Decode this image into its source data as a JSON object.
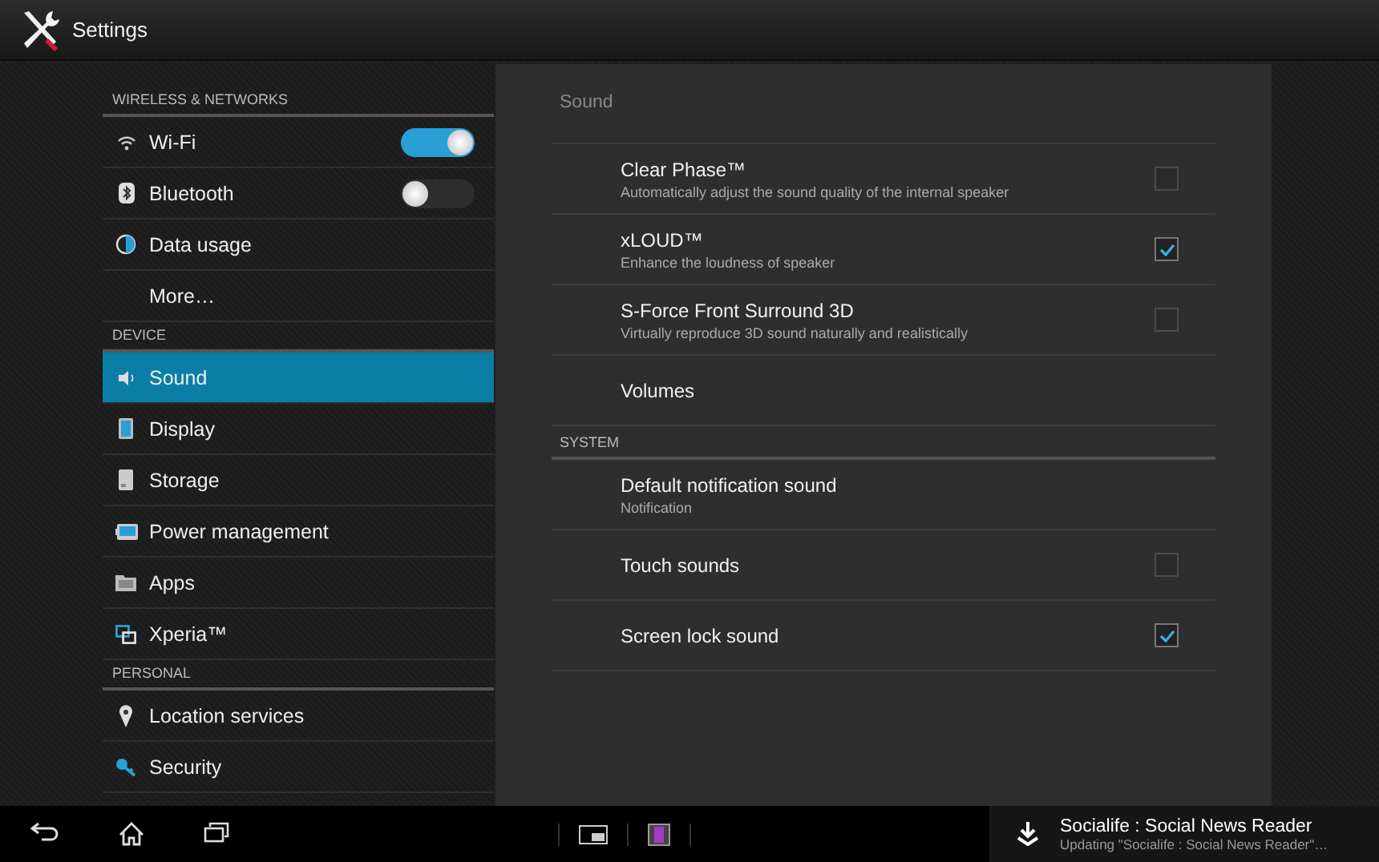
{
  "title_bar": {
    "title": "Settings"
  },
  "sidebar": {
    "sections": [
      {
        "header": "WIRELESS & NETWORKS",
        "items": [
          {
            "label": "Wi-Fi",
            "kind": "switch",
            "on": true,
            "selected": false
          },
          {
            "label": "Bluetooth",
            "kind": "switch",
            "on": false,
            "selected": false
          },
          {
            "label": "Data usage",
            "kind": "link",
            "selected": false
          },
          {
            "label": "More…",
            "kind": "link",
            "selected": false
          }
        ]
      },
      {
        "header": "DEVICE",
        "items": [
          {
            "label": "Sound",
            "kind": "link",
            "selected": true
          },
          {
            "label": "Display",
            "kind": "link",
            "selected": false
          },
          {
            "label": "Storage",
            "kind": "link",
            "selected": false
          },
          {
            "label": "Power management",
            "kind": "link",
            "selected": false
          },
          {
            "label": "Apps",
            "kind": "link",
            "selected": false
          },
          {
            "label": "Xperia™",
            "kind": "link",
            "selected": false
          }
        ]
      },
      {
        "header": "PERSONAL",
        "items": [
          {
            "label": "Location services",
            "kind": "link",
            "selected": false
          },
          {
            "label": "Security",
            "kind": "link",
            "selected": false
          }
        ]
      }
    ]
  },
  "content": {
    "title": "Sound",
    "sections": [
      {
        "items": [
          {
            "title": "Clear Phase™",
            "summary": "Automatically adjust the sound quality of the internal speaker",
            "kind": "checkbox",
            "checked": false
          },
          {
            "title": "xLOUD™",
            "summary": "Enhance the loudness of speaker",
            "kind": "checkbox",
            "checked": true
          },
          {
            "title": "S-Force Front Surround 3D",
            "summary": "Virtually reproduce 3D sound naturally and realistically",
            "kind": "checkbox",
            "checked": false
          },
          {
            "title": "Volumes",
            "kind": "link"
          }
        ]
      },
      {
        "header": "SYSTEM",
        "items": [
          {
            "title": "Default notification sound",
            "summary": "Notification",
            "kind": "link"
          },
          {
            "title": "Touch sounds",
            "kind": "checkbox",
            "checked": false
          },
          {
            "title": "Screen lock sound",
            "kind": "checkbox",
            "checked": true
          }
        ]
      }
    ]
  },
  "notification": {
    "title": "Socialife : Social News Reader",
    "text": "Updating \"Socialife : Social News Reader\"…"
  }
}
